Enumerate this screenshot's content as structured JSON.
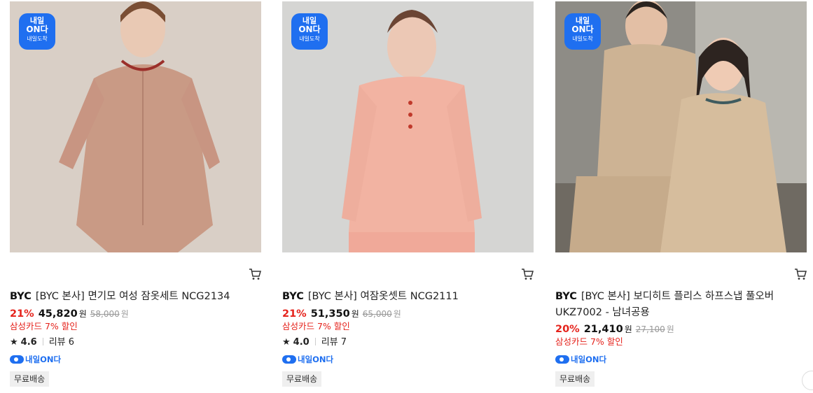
{
  "products": [
    {
      "badge": {
        "line1": "내일",
        "line2": "ON다",
        "line3": "내일도착"
      },
      "brand": "BYC",
      "name": "[BYC 본사] 면기모 여성 잠옷세트 NCG2134",
      "discount_rate": "21%",
      "price": "45,820",
      "currency": "원",
      "original_price": "58,000",
      "card_discount": "삼성카드 7% 할인",
      "rating": "4.6",
      "review_label": "리뷰 6",
      "delivery_tag": "내일ON다",
      "shipping": "무료배송"
    },
    {
      "badge": {
        "line1": "내일",
        "line2": "ON다",
        "line3": "내일도착"
      },
      "brand": "BYC",
      "name": "[BYC 본사] 여잠옷셋트 NCG2111",
      "discount_rate": "21%",
      "price": "51,350",
      "currency": "원",
      "original_price": "65,000",
      "card_discount": "삼성카드 7% 할인",
      "rating": "4.0",
      "review_label": "리뷰 7",
      "delivery_tag": "내일ON다",
      "shipping": "무료배송"
    },
    {
      "badge": {
        "line1": "내일",
        "line2": "ON다",
        "line3": "내일도착"
      },
      "brand": "BYC",
      "name": "[BYC 본사] 보디히트 플리스 하프스냅 풀오버 UKZ7002 - 남녀공용",
      "discount_rate": "20%",
      "price": "21,410",
      "currency": "원",
      "original_price": "27,100",
      "card_discount": "삼성카드 7% 할인",
      "delivery_tag": "내일ON다",
      "shipping": "무료배송"
    }
  ],
  "icons": {
    "cart": "cart-icon",
    "star": "star-icon",
    "delivery": "delivery-truck-icon"
  },
  "colors": {
    "discount": "#e5231c",
    "badge": "#1f6ff0",
    "tag_bg": "#efefef"
  }
}
